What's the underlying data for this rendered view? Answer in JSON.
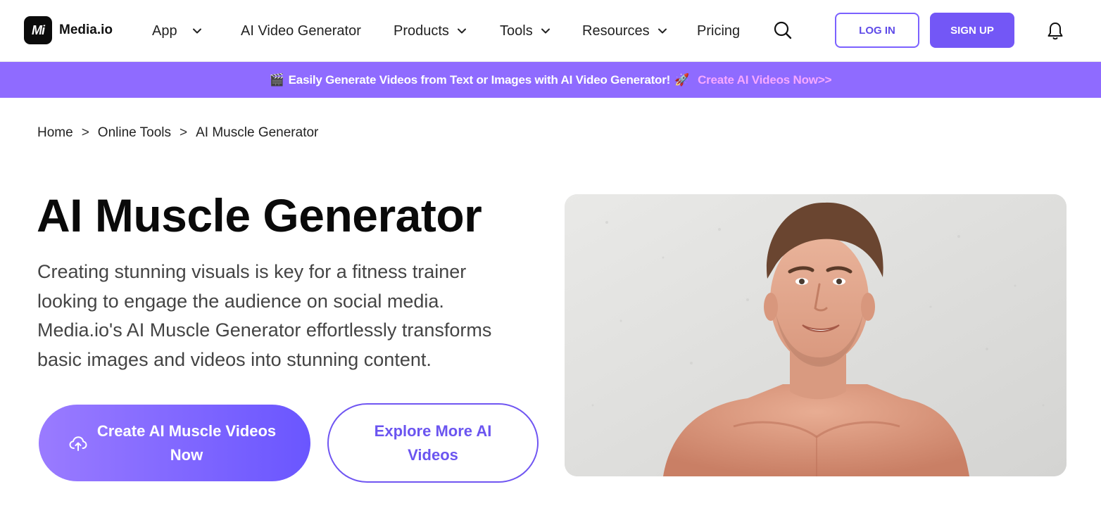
{
  "header": {
    "logo_mark": "Mi",
    "logo_text": "Media.io",
    "nav": [
      {
        "label": "App",
        "has_dropdown": true
      },
      {
        "label": "AI Video Generator",
        "has_dropdown": false
      },
      {
        "label": "Products",
        "has_dropdown": true
      },
      {
        "label": "Tools",
        "has_dropdown": true
      },
      {
        "label": "Resources",
        "has_dropdown": true
      },
      {
        "label": "Pricing",
        "has_dropdown": false
      }
    ],
    "login_label": "LOG IN",
    "signup_label": "SIGN UP",
    "icons": {
      "search": "search-icon",
      "notifications": "bell-icon",
      "dropdown": "chevron-down-icon"
    }
  },
  "banner": {
    "emoji_start": "🎬",
    "text": "Easily Generate Videos from Text or Images with AI Video Generator!",
    "emoji_mid": "🚀",
    "link": "Create AI Videos Now>>"
  },
  "breadcrumb": {
    "items": [
      "Home",
      "Online Tools",
      "AI Muscle Generator"
    ],
    "separator": ">"
  },
  "hero": {
    "title": "AI Muscle Generator",
    "description": "Creating stunning visuals is key for a fitness trainer looking to engage the audience on social media. Media.io's AI Muscle Generator effortlessly transforms basic images and videos into stunning content.",
    "primary_button": "Create AI Muscle Videos Now",
    "secondary_button": "Explore More AI Videos",
    "primary_icon": "cloud-upload-icon"
  },
  "colors": {
    "accent": "#7357f6",
    "banner_bg": "#8f6bff",
    "banner_link": "#f7a8ff",
    "gradient_start": "#9a7bff",
    "gradient_end": "#6a56ff"
  }
}
